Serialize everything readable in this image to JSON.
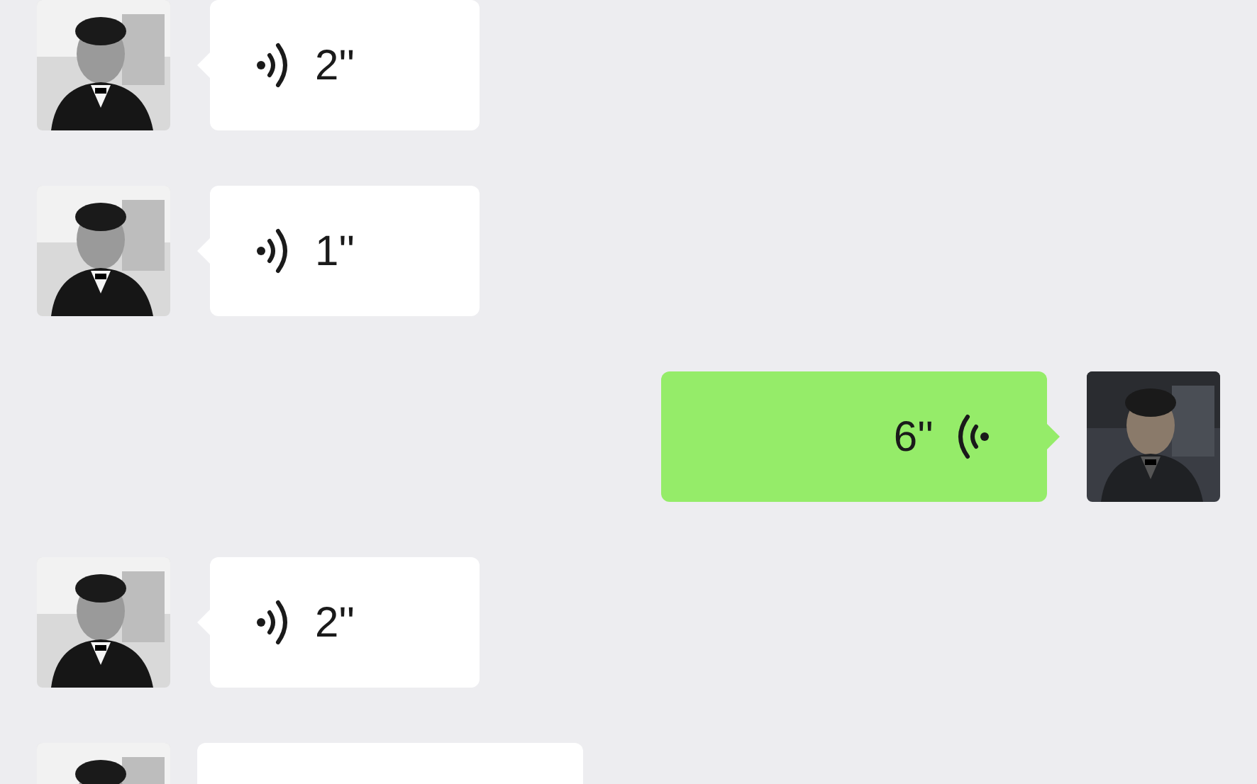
{
  "messages": [
    {
      "outgoing": false,
      "kind": "voice",
      "duration": "2''"
    },
    {
      "outgoing": false,
      "kind": "voice",
      "duration": "1''"
    },
    {
      "outgoing": true,
      "kind": "voice",
      "duration": "6''"
    },
    {
      "outgoing": false,
      "kind": "voice",
      "duration": "2''"
    },
    {
      "outgoing": false
    }
  ]
}
